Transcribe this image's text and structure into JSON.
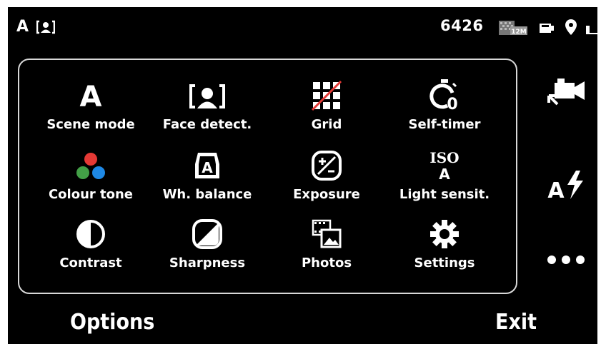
{
  "status_bar": {
    "scene_mode_indicator": "A",
    "face_detect_icon": "face-detect-icon",
    "shots_remaining": "6426",
    "resolution_badge": "12M",
    "storage_icon": "storage-icon",
    "gps_icon": "location-pin-icon",
    "battery_icon": "battery-icon"
  },
  "menu": {
    "items": [
      {
        "label": "Scene mode",
        "icon": "scene-auto-icon",
        "icon_text": "A"
      },
      {
        "label": "Face detect.",
        "icon": "face-detect-icon"
      },
      {
        "label": "Grid",
        "icon": "grid-off-icon"
      },
      {
        "label": "Self-timer",
        "icon": "self-timer-icon",
        "icon_text": "0"
      },
      {
        "label": "Colour tone",
        "icon": "colour-tone-icon"
      },
      {
        "label": "Wh. balance",
        "icon": "white-balance-icon",
        "icon_text": "A"
      },
      {
        "label": "Exposure",
        "icon": "exposure-icon"
      },
      {
        "label": "Light sensit.",
        "icon": "iso-icon",
        "icon_text_top": "ISO",
        "icon_text_bottom": "A"
      },
      {
        "label": "Contrast",
        "icon": "contrast-icon"
      },
      {
        "label": "Sharpness",
        "icon": "sharpness-icon"
      },
      {
        "label": "Photos",
        "icon": "photos-icon"
      },
      {
        "label": "Settings",
        "icon": "settings-gear-icon"
      }
    ]
  },
  "side_toolbar": {
    "video_mode": "video-camera-icon",
    "flash": {
      "icon": "flash-auto-icon",
      "text": "A"
    },
    "more": "more-dots-icon"
  },
  "softkeys": {
    "left": "Options",
    "right": "Exit"
  },
  "colors": {
    "background": "#000000",
    "foreground": "#ffffff",
    "panel_border": "#d8d8d8",
    "tone_red": "#e53935",
    "tone_green": "#43a047",
    "tone_blue": "#1e88e5",
    "grid_strike": "#e53935"
  }
}
